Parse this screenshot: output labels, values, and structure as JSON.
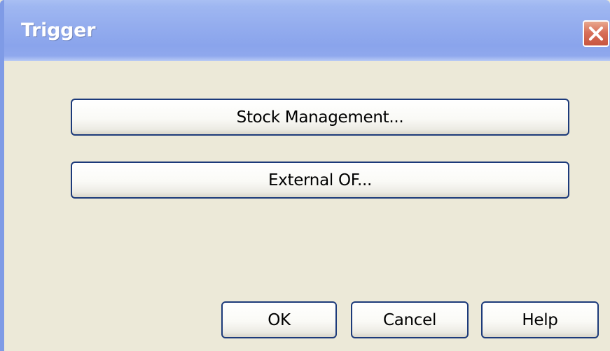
{
  "window": {
    "title": "Trigger",
    "close_icon": "close-icon"
  },
  "buttons": {
    "stock_management": "Stock Management...",
    "external_of": "External OF...",
    "ok": "OK",
    "cancel": "Cancel",
    "help": "Help"
  },
  "colors": {
    "titlebar": "#93acee",
    "dialog_background": "#ece9d8",
    "close_button": "#d8705a",
    "button_border": "#1c3a7a"
  }
}
